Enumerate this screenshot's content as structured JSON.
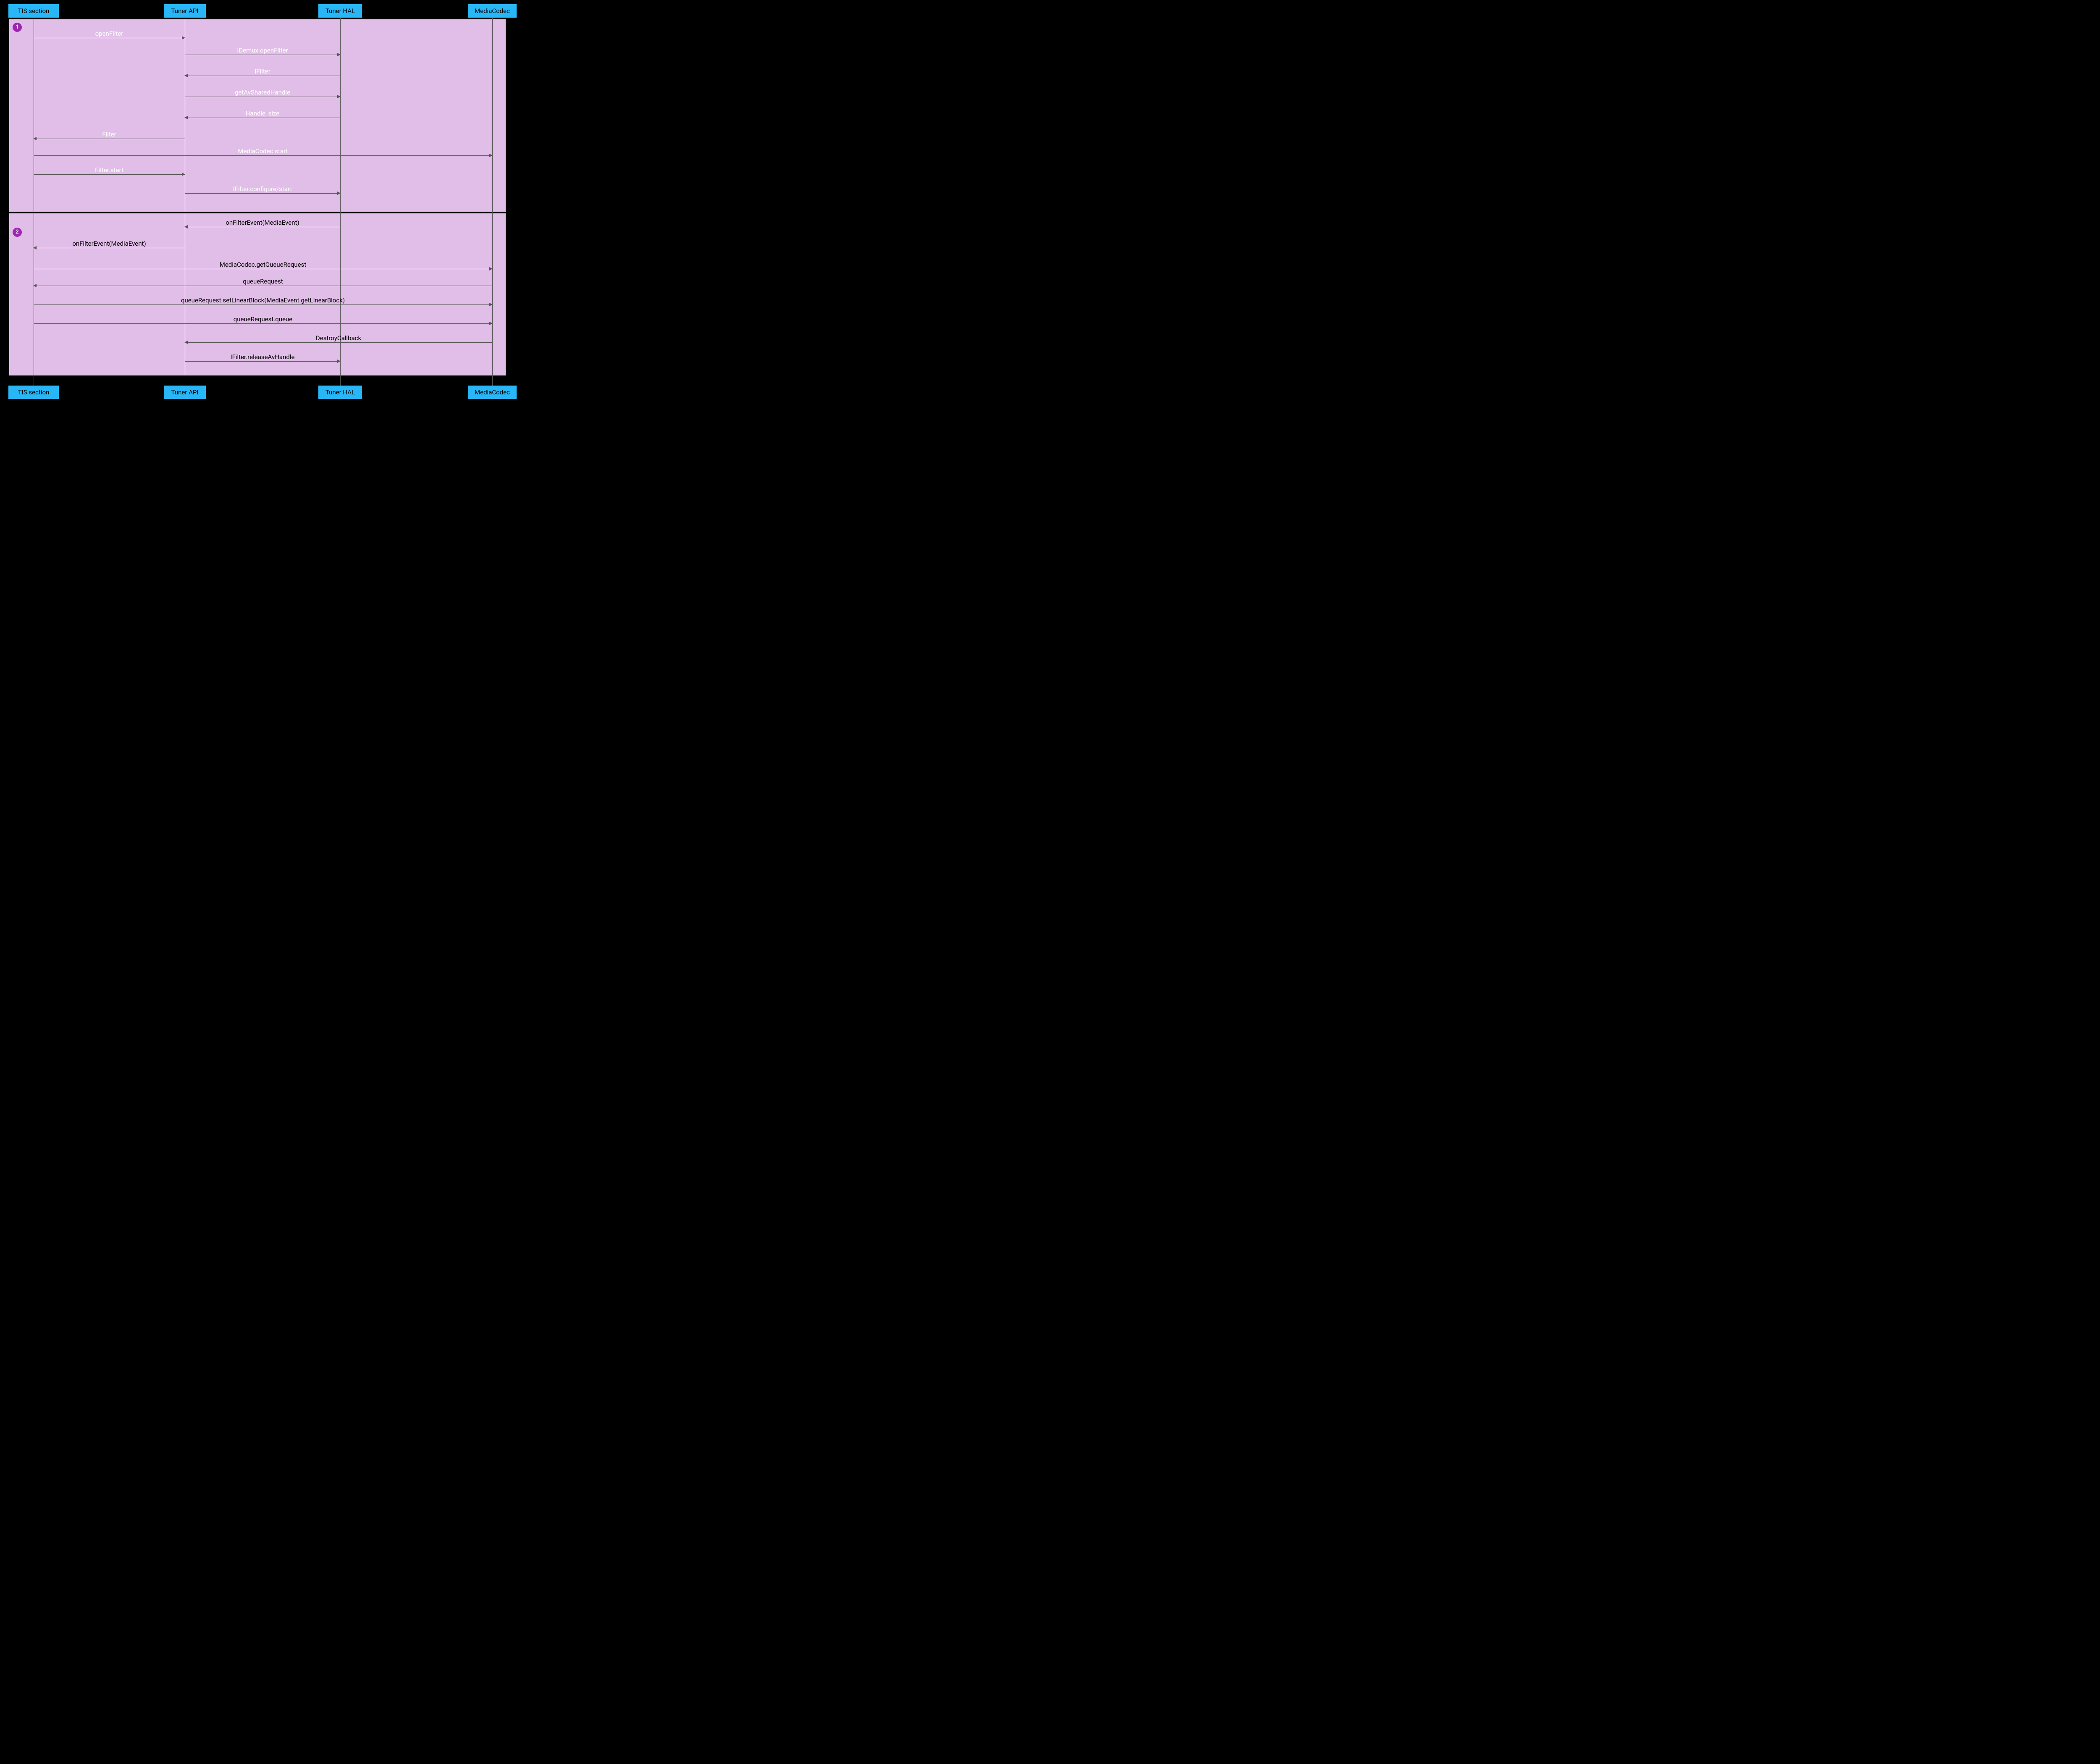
{
  "participants": {
    "tis": "TIS section",
    "api": "Tuner API",
    "hal": "Tuner HAL",
    "codec": "MediaCodec"
  },
  "zones": {
    "one": {
      "label": "1"
    },
    "two": {
      "label": "2"
    }
  },
  "messages": {
    "m1": "openFilter",
    "m2": "IDemux.openFilter",
    "m3": "IFilter",
    "m4": "getAvSharedHandle",
    "m5": "Handle, size",
    "m6": "Filter",
    "m7": "MediaCodec.start",
    "m8": "Filter.start",
    "m9": "IFilter.configure/start",
    "m10": "onFilterEvent(MediaEvent)",
    "m11": "onFilterEvent(MediaEvent)",
    "m12": "MediaCodec.getQueueRequest",
    "m13": "queueRequest",
    "m14": "queueRequest.setLinearBlock(MediaEvent.getLinearBlock)",
    "m15": "queueRequest.queue",
    "m16": "DestroyCallback",
    "m17": "IFilter.releaseAvHandle"
  }
}
